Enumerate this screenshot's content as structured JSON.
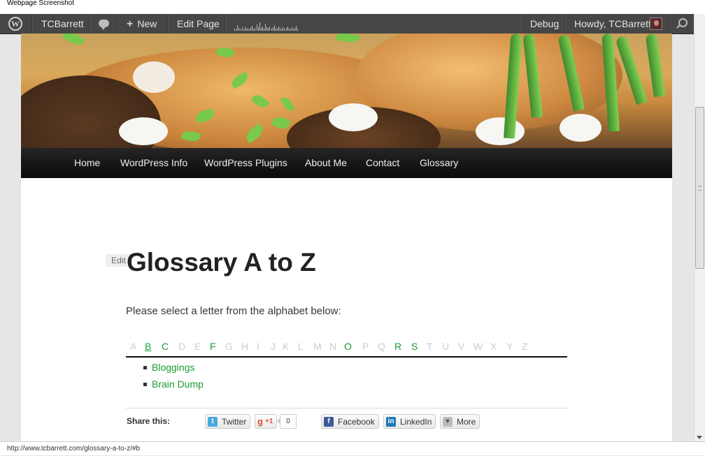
{
  "window": {
    "title": "Webpage Screenshot"
  },
  "adminbar": {
    "site_name": "TCBarrett",
    "new_label": "New",
    "edit_page_label": "Edit Page",
    "debug_label": "Debug",
    "howdy_label": "Howdy, TCBarrett"
  },
  "nav": {
    "items": [
      {
        "label": "Home"
      },
      {
        "label": "WordPress Info"
      },
      {
        "label": "WordPress Plugins"
      },
      {
        "label": "About Me"
      },
      {
        "label": "Contact"
      },
      {
        "label": "Glossary"
      }
    ]
  },
  "content": {
    "edit_label": "Edit",
    "title": "Glossary A to Z",
    "intro": "Please select a letter from the alphabet below:"
  },
  "alphabet": {
    "letters": [
      "A",
      "B",
      "C",
      "D",
      "E",
      "F",
      "G",
      "H",
      "I",
      "J",
      "K",
      "L",
      "M",
      "N",
      "O",
      "P",
      "Q",
      "R",
      "S",
      "T",
      "U",
      "V",
      "W",
      "X",
      "Y",
      "Z"
    ],
    "active": [
      "B",
      "C",
      "F",
      "O",
      "R",
      "S"
    ],
    "current": "B",
    "active_color": "#1a9c2e",
    "inactive_color": "#cccccc"
  },
  "terms": [
    {
      "label": "Bloggings"
    },
    {
      "label": "Brain Dump"
    }
  ],
  "share": {
    "label": "Share this:",
    "twitter": "Twitter",
    "gplus_label": "+1",
    "gplus_count": "0",
    "facebook": "Facebook",
    "linkedin": "LinkedIn",
    "more": "More"
  },
  "statusbar": {
    "url": "http://www.tcbarrett.com/glossary-a-to-z/#b"
  }
}
